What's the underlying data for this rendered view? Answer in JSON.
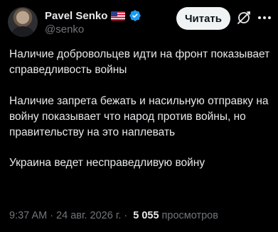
{
  "author": {
    "display_name": "Pavel Senko",
    "handle": "@senko",
    "flag_icon": "us-flag-icon",
    "verified_icon": "verified-badge-icon"
  },
  "header": {
    "follow_label": "Читать",
    "grok_icon": "grok-icon",
    "more_icon": "more-dots-icon"
  },
  "tweet": {
    "paragraphs": [
      "Наличие добровольцев идти на фронт показывает справедливость войны",
      "Наличие запрета бежать и насильную отправку на войну показывает что народ против войны, но правительству на это наплевать",
      "Украина ведет несправедливую войну"
    ]
  },
  "meta": {
    "time": "9:37 AM",
    "separator": "·",
    "date": "24 авг. 2026 г.",
    "views_count": "5 055",
    "views_label": "просмотров"
  },
  "colors": {
    "background": "#000000",
    "text": "#e7e9ea",
    "secondary": "#71767b",
    "verified": "#1d9bf0",
    "button_bg": "#eff3f4"
  }
}
